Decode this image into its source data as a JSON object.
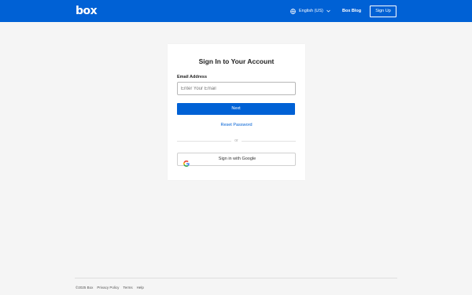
{
  "header": {
    "logo_text": "box",
    "language_label": "English (US)",
    "blog_link": "Box Blog",
    "signup_button": "Sign Up",
    "brand_color": "#0061d5"
  },
  "login": {
    "title": "Sign In to Your Account",
    "email_label": "Email Address",
    "email_placeholder": "Enter Your Email",
    "email_value": "",
    "next_button": "Next",
    "reset_link": "Reset Password",
    "divider_text": "or",
    "google_button": "Sign in with Google"
  },
  "footer": {
    "copyright": "©2025 Box",
    "links": [
      "Privacy Policy",
      "Terms",
      "Help"
    ]
  },
  "icons": {
    "language": "globe-icon",
    "dropdown": "chevron-down-icon",
    "google": "google-icon"
  }
}
